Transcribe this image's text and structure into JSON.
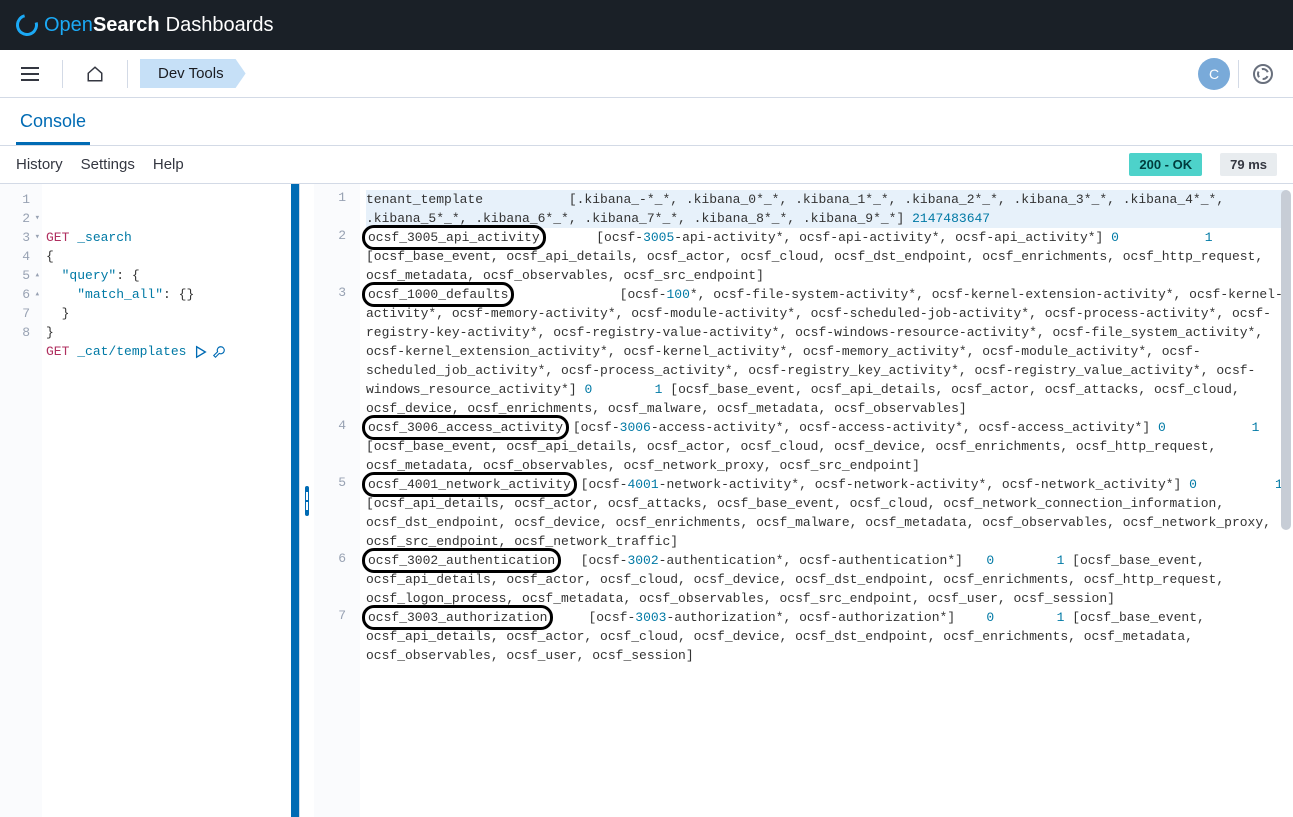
{
  "brand": {
    "open": "Open",
    "search": "Search",
    "dashboards": "Dashboards"
  },
  "breadcrumb": "Dev Tools",
  "avatar_initial": "C",
  "tab": "Console",
  "toolbar": {
    "history": "History",
    "settings": "Settings",
    "help": "Help"
  },
  "status": {
    "code": "200 - OK",
    "timing": "79 ms"
  },
  "request": {
    "lines": [
      {
        "n": "1",
        "text": "GET _search",
        "method": "GET",
        "path": "_search"
      },
      {
        "n": "2",
        "text": "{",
        "fold": "open"
      },
      {
        "n": "3",
        "text": "  \"query\": {",
        "fold": "open",
        "key": "\"query\""
      },
      {
        "n": "4",
        "text": "    \"match_all\": {}",
        "key": "\"match_all\""
      },
      {
        "n": "5",
        "text": "  }",
        "fold": "close"
      },
      {
        "n": "6",
        "text": "}",
        "fold": "close"
      },
      {
        "n": "7",
        "text": ""
      },
      {
        "n": "8",
        "text": "GET _cat/templates",
        "method": "GET",
        "path": "_cat/templates",
        "active": true
      }
    ]
  },
  "response": {
    "entries": [
      {
        "n": "1",
        "name": "tenant_template",
        "first_row": true,
        "body_html": "[.kibana_-*_*, .kibana_0*_*, .kibana_1*_*, .kibana_2*_*, .kibana_3*_*, .kibana_4*_*, .kibana_5*_*, .kibana_6*_*, .kibana_7*_*, .kibana_8*_*, .kibana_9*_*] <span class='numlit'>2147483647</span>"
      },
      {
        "n": "2",
        "name": "ocsf_3005_api_activity",
        "boxed": true,
        "body_html": "   [ocsf-<span class='numlit'>3005</span>-api-activity*, ocsf-api-activity*, ocsf-api_activity*] <span class='numlit'>0</span>           <span class='numlit'>1</span> [ocsf_base_event, ocsf_api_details, ocsf_actor, ocsf_cloud, ocsf_dst_endpoint, ocsf_enrichments, ocsf_http_request, ocsf_metadata, ocsf_observables, ocsf_src_endpoint]"
      },
      {
        "n": "3",
        "name": "ocsf_1000_defaults",
        "boxed": true,
        "body_html": "      [ocsf-<span class='numlit'>100</span>*, ocsf-file-system-activity*, ocsf-kernel-extension-activity*, ocsf-kernel-activity*, ocsf-memory-activity*, ocsf-module-activity*, ocsf-scheduled-job-activity*, ocsf-process-activity*, ocsf-registry-key-activity*, ocsf-registry-value-activity*, ocsf-windows-resource-activity*, ocsf-file_system_activity*, ocsf-kernel_extension_activity*, ocsf-kernel_activity*, ocsf-memory_activity*, ocsf-module_activity*, ocsf-scheduled_job_activity*, ocsf-process_activity*, ocsf-registry_key_activity*, ocsf-registry_value_activity*, ocsf-windows_resource_activity*] <span class='numlit'>0</span>        <span class='numlit'>1</span> [ocsf_base_event, ocsf_api_details, ocsf_actor, ocsf_attacks, ocsf_cloud, ocsf_device, ocsf_enrichments, ocsf_malware, ocsf_metadata, ocsf_observables]"
      },
      {
        "n": "4",
        "name": "ocsf_3006_access_activity",
        "boxed": true,
        "body_html": "[ocsf-<span class='numlit'>3006</span>-access-activity*, ocsf-access-activity*, ocsf-access_activity*] <span class='numlit'>0</span>           <span class='numlit'>1</span> [ocsf_base_event, ocsf_api_details, ocsf_actor, ocsf_cloud, ocsf_device, ocsf_enrichments, ocsf_http_request, ocsf_metadata, ocsf_observables, ocsf_network_proxy, ocsf_src_endpoint]"
      },
      {
        "n": "5",
        "name": "ocsf_4001_network_activity",
        "boxed": true,
        "body_html": "[ocsf-<span class='numlit'>4001</span>-network-activity*, ocsf-network-activity*, ocsf-network_activity*] <span class='numlit'>0</span>          <span class='numlit'>1</span> [ocsf_api_details, ocsf_actor, ocsf_attacks, ocsf_base_event, ocsf_cloud, ocsf_network_connection_information, ocsf_dst_endpoint, ocsf_device, ocsf_enrichments, ocsf_malware, ocsf_metadata, ocsf_observables, ocsf_network_proxy, ocsf_src_endpoint, ocsf_network_traffic]"
      },
      {
        "n": "6",
        "name": "ocsf_3002_authentication",
        "boxed": true,
        "body_html": " [ocsf-<span class='numlit'>3002</span>-authentication*, ocsf-authentication*]   <span class='numlit'>0</span>        <span class='numlit'>1</span> [ocsf_base_event, ocsf_api_details, ocsf_actor, ocsf_cloud, ocsf_device, ocsf_dst_endpoint, ocsf_enrichments, ocsf_http_request, ocsf_logon_process, ocsf_metadata, ocsf_observables, ocsf_src_endpoint, ocsf_user, ocsf_session]"
      },
      {
        "n": "7",
        "name": "ocsf_3003_authorization",
        "boxed": true,
        "body_html": "  [ocsf-<span class='numlit'>3003</span>-authorization*, ocsf-authorization*]    <span class='numlit'>0</span>        <span class='numlit'>1</span> [ocsf_base_event, ocsf_api_details, ocsf_actor, ocsf_cloud, ocsf_device, ocsf_dst_endpoint, ocsf_enrichments, ocsf_metadata, ocsf_observables, ocsf_user, ocsf_session]"
      }
    ]
  }
}
